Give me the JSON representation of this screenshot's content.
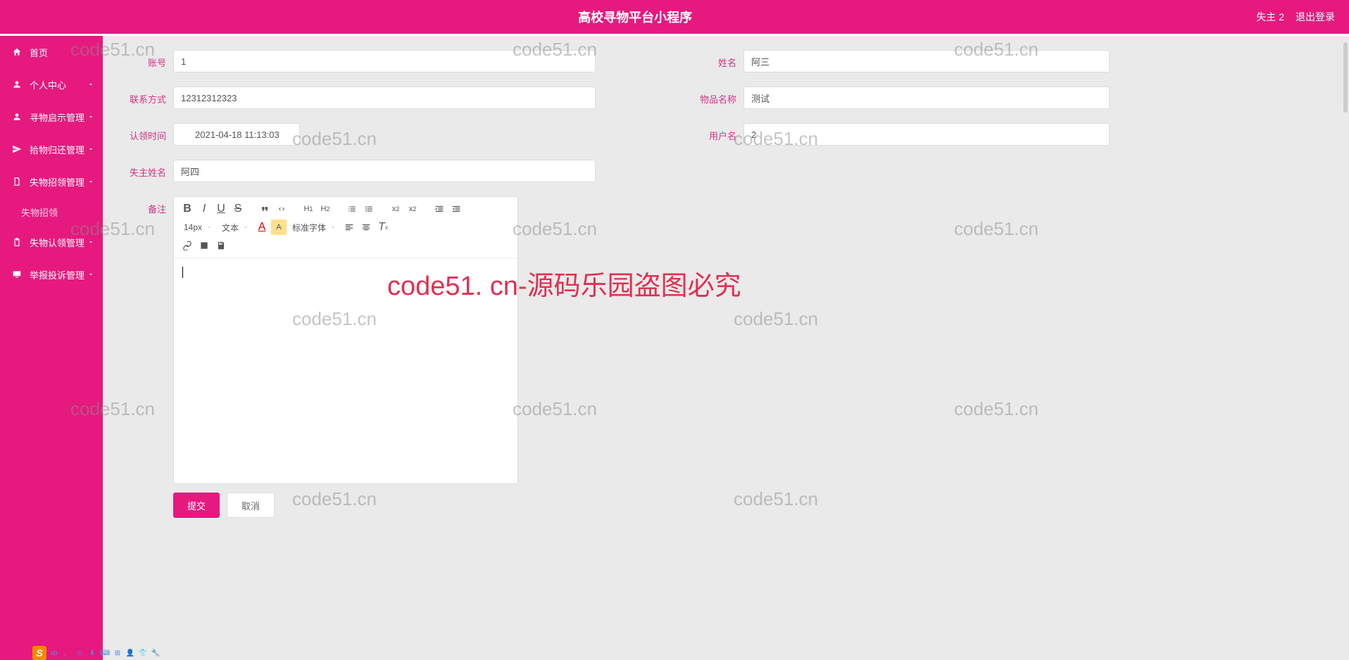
{
  "header": {
    "title": "高校寻物平台小程序",
    "user_label": "失主 2",
    "logout_label": "退出登录"
  },
  "sidebar": {
    "items": [
      {
        "label": "首页",
        "icon": "home",
        "has_children": false
      },
      {
        "label": "个人中心",
        "icon": "user",
        "has_children": true,
        "expanded": false
      },
      {
        "label": "寻物启示管理",
        "icon": "user",
        "has_children": true,
        "expanded": false
      },
      {
        "label": "拾物归还管理",
        "icon": "send",
        "has_children": true,
        "expanded": false
      },
      {
        "label": "失物招领管理",
        "icon": "doc",
        "has_children": true,
        "expanded": true,
        "children": [
          {
            "label": "失物招领"
          }
        ]
      },
      {
        "label": "失物认领管理",
        "icon": "clipboard",
        "has_children": true,
        "expanded": false
      },
      {
        "label": "举报投诉管理",
        "icon": "monitor",
        "has_children": true,
        "expanded": false
      }
    ]
  },
  "form": {
    "account_label": "账号",
    "account_value": "1",
    "name_label": "姓名",
    "name_value": "阿三",
    "contact_label": "联系方式",
    "contact_value": "12312312323",
    "item_label": "物品名称",
    "item_value": "测试",
    "claim_time_label": "认领时间",
    "claim_time_value": "2021-04-18 11:13:03",
    "username_label": "用户名",
    "username_value": "2",
    "loser_label": "失主姓名",
    "loser_value": "阿四",
    "remark_label": "备注",
    "submit_label": "提交",
    "cancel_label": "取消"
  },
  "editor": {
    "fontsize": "14px",
    "style_text": "文本",
    "font_family": "标准字体",
    "content": ""
  },
  "watermarks": {
    "text": "code51.cn",
    "big": "code51. cn-源码乐园盗图必究"
  },
  "taskbar": {
    "items": [
      "中",
      "、",
      "☺",
      "⬇",
      "⌨",
      "⊞",
      "👤",
      "👕",
      "🔧"
    ]
  }
}
